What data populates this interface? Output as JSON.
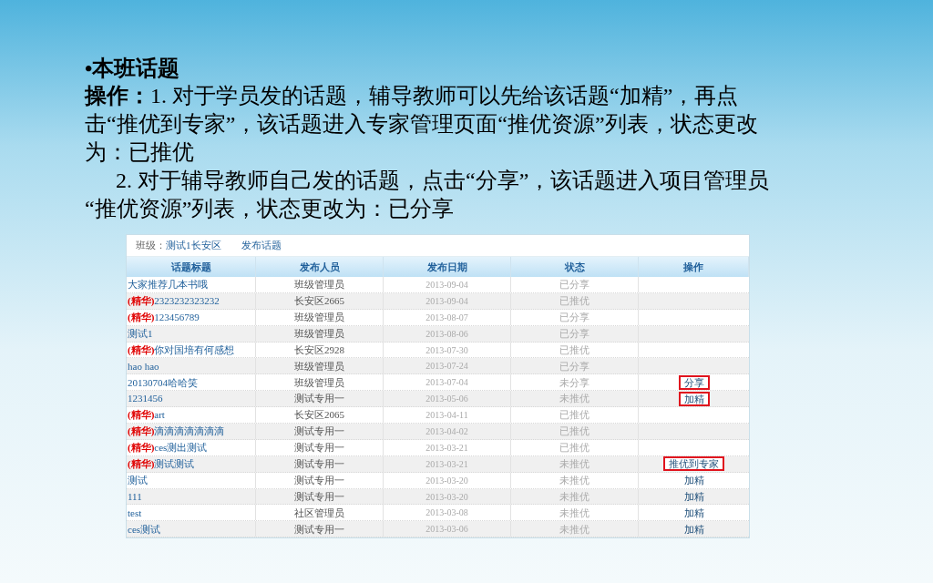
{
  "slide": {
    "heading": "•本班话题",
    "paragraphs": [
      "**操作：**1. 对于学员发的话题，辅导教师可以先给该话题“加精”，再点击“推优到专家”，该话题进入专家管理页面“推优资源”列表，状态更改为：已推优",
      "2. 对于辅导教师自己发的话题，点击“分享”，该话题进入项目管理员 “推优资源”列表，状态更改为：已分享"
    ]
  },
  "toolbar": {
    "class_label": "班级：",
    "class_link": "测试1长安区",
    "post_link": "发布话题"
  },
  "table": {
    "columns": [
      "话题标题",
      "发布人员",
      "发布日期",
      "状态",
      "操作"
    ],
    "rows": [
      {
        "title": "大家推荐几本书哦",
        "author": "班级管理员",
        "date": "2013-09-04",
        "status": "已分享"
      },
      {
        "tag": "(精华)",
        "title": "2323232323232",
        "author": "长安区2665",
        "date": "2013-09-04",
        "status": "已推优"
      },
      {
        "tag": "(精华)",
        "title": "123456789",
        "author": "班级管理员",
        "date": "2013-08-07",
        "status": "已分享"
      },
      {
        "title": "测试1",
        "author": "班级管理员",
        "date": "2013-08-06",
        "status": "已分享"
      },
      {
        "tag": "(精华)",
        "title": "你对国培有何感想",
        "author": "长安区2928",
        "date": "2013-07-30",
        "status": "已推优"
      },
      {
        "title": "hao hao",
        "author": "班级管理员",
        "date": "2013-07-24",
        "status": "已分享"
      },
      {
        "title": "20130704哈哈笑",
        "author": "班级管理员",
        "date": "2013-07-04",
        "status": "未分享",
        "action": "分享",
        "highlighted": true
      },
      {
        "title": "1231456",
        "author": "测试专用一",
        "date": "2013-05-06",
        "status": "未推优",
        "action": "加精",
        "highlighted": true
      },
      {
        "tag": "(精华)",
        "title": "art",
        "author": "长安区2065",
        "date": "2013-04-11",
        "status": "已推优"
      },
      {
        "tag": "(精华)",
        "title": "滴滴滴滴滴滴滴",
        "author": "测试专用一",
        "date": "2013-04-02",
        "status": "已推优"
      },
      {
        "tag": "(精华)",
        "title": "ces测出测试",
        "author": "测试专用一",
        "date": "2013-03-21",
        "status": "已推优"
      },
      {
        "tag": "(精华)",
        "title": "测试测试",
        "author": "测试专用一",
        "date": "2013-03-21",
        "status": "未推优",
        "action": "推优到专家",
        "highlighted": true
      },
      {
        "title": "测试",
        "author": "测试专用一",
        "date": "2013-03-20",
        "status": "未推优",
        "action": "加精",
        "highlighted": false
      },
      {
        "title": "111",
        "author": "测试专用一",
        "date": "2013-03-20",
        "status": "未推优",
        "action": "加精",
        "highlighted": false
      },
      {
        "title": "test",
        "author": "社区管理员",
        "date": "2013-03-08",
        "status": "未推优",
        "action": "加精",
        "highlighted": false
      },
      {
        "title": "ces测试",
        "author": "测试专用一",
        "date": "2013-03-06",
        "status": "未推优",
        "action": "加精",
        "highlighted": false
      }
    ]
  }
}
